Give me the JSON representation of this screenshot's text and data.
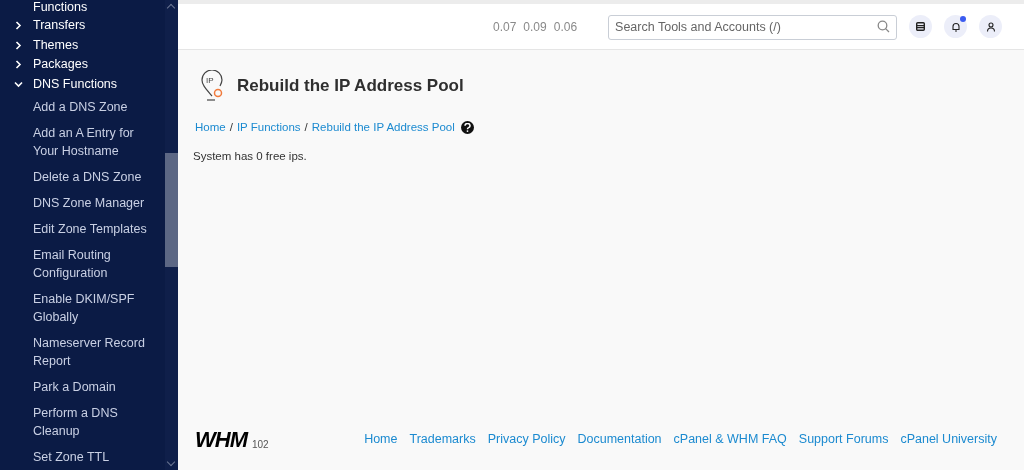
{
  "sidebar": {
    "cut_label": "Functions",
    "items": [
      {
        "label": "Transfers",
        "expanded": false
      },
      {
        "label": "Themes",
        "expanded": false
      },
      {
        "label": "Packages",
        "expanded": false
      },
      {
        "label": "DNS Functions",
        "expanded": true,
        "children": [
          "Add a DNS Zone",
          "Add an A Entry for Your Hostname",
          "Delete a DNS Zone",
          "DNS Zone Manager",
          "Edit Zone Templates",
          "Email Routing Configuration",
          "Enable DKIM/SPF Globally",
          "Nameserver Record Report",
          "Park a Domain",
          "Perform a DNS Cleanup",
          "Set Zone TTL"
        ]
      }
    ]
  },
  "header": {
    "load_averages": [
      "0.07",
      "0.09",
      "0.06"
    ],
    "search": {
      "placeholder": "Search Tools and Accounts (/)"
    },
    "notifications_unread": true
  },
  "page": {
    "icon_text": "IP",
    "title": "Rebuild the IP Address Pool",
    "breadcrumb_separator": "/",
    "breadcrumbs": [
      "Home",
      "IP Functions",
      "Rebuild the IP Address Pool"
    ],
    "message": "System has 0 free ips."
  },
  "footer": {
    "logo": "WHM",
    "version": "102",
    "links": [
      "Home",
      "Trademarks",
      "Privacy Policy",
      "Documentation",
      "cPanel & WHM FAQ",
      "Support Forums",
      "cPanel University"
    ]
  }
}
